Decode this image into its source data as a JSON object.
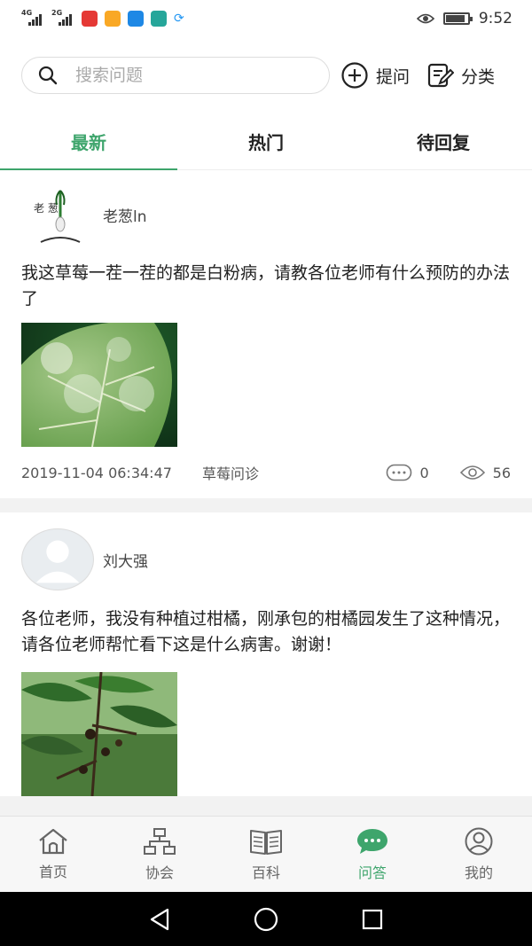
{
  "status_bar": {
    "net1": "4G",
    "net2": "2G",
    "time": "9:52",
    "battery_level": 0.9
  },
  "search": {
    "placeholder": "搜索问题",
    "ask_label": "提问",
    "category_label": "分类"
  },
  "tabs": [
    {
      "label": "最新",
      "active": true
    },
    {
      "label": "热门",
      "active": false
    },
    {
      "label": "待回复",
      "active": false
    }
  ],
  "posts": [
    {
      "author": "老葱ln",
      "avatar_text": "老  葱",
      "text": "我这草莓一茬一茬的都是白粉病，请教各位老师有什么预防的办法了",
      "date": "2019-11-04 06:34:47",
      "category": "草莓问诊",
      "comments": "0",
      "views": "56"
    },
    {
      "author": "刘大强",
      "text": "各位老师，我没有种植过柑橘，刚承包的柑橘园发生了这种情况，请各位老师帮忙看下这是什么病害。谢谢！"
    }
  ],
  "bottom_nav": [
    {
      "label": "首页",
      "icon": "home-icon",
      "active": false
    },
    {
      "label": "协会",
      "icon": "organization-icon",
      "active": false
    },
    {
      "label": "百科",
      "icon": "book-icon",
      "active": false
    },
    {
      "label": "问答",
      "icon": "chat-bubble-icon",
      "active": true
    },
    {
      "label": "我的",
      "icon": "user-icon",
      "active": false
    }
  ],
  "colors": {
    "accent": "#3ea56c"
  }
}
